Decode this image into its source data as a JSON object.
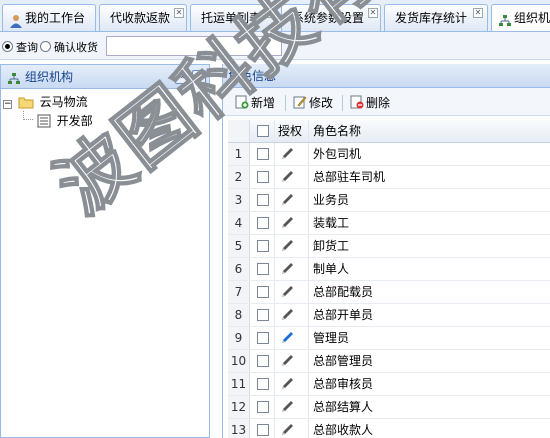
{
  "tabs": [
    {
      "label": "我的工作台",
      "closable": false,
      "active": false
    },
    {
      "label": "代收款返款",
      "closable": true,
      "active": false
    },
    {
      "label": "托运单列表",
      "closable": true,
      "active": false
    },
    {
      "label": "系统参数设置",
      "closable": true,
      "active": false
    },
    {
      "label": "发货库存统计",
      "closable": true,
      "active": false
    },
    {
      "label": "组织机",
      "closable": false,
      "active": true
    }
  ],
  "filter": {
    "radio_query": "查询",
    "radio_confirm": "确认收货",
    "input_value": ""
  },
  "left_panel": {
    "title": "组织机构",
    "tree": [
      {
        "label": "云马物流"
      },
      {
        "label": "开发部"
      }
    ]
  },
  "right_panel": {
    "title": "角色信息",
    "toolbar": {
      "add": "新增",
      "edit": "修改",
      "delete": "删除"
    },
    "grid": {
      "col_auth": "授权",
      "col_name": "角色名称",
      "rows": [
        {
          "num": "1",
          "name": "外包司机"
        },
        {
          "num": "2",
          "name": "总部驻车司机"
        },
        {
          "num": "3",
          "name": "业务员"
        },
        {
          "num": "4",
          "name": "装载工"
        },
        {
          "num": "5",
          "name": "卸货工"
        },
        {
          "num": "6",
          "name": "制单人"
        },
        {
          "num": "7",
          "name": "总部配载员"
        },
        {
          "num": "8",
          "name": "总部开单员"
        },
        {
          "num": "9",
          "name": "管理员"
        },
        {
          "num": "10",
          "name": "总部管理员"
        },
        {
          "num": "11",
          "name": "总部审核员"
        },
        {
          "num": "12",
          "name": "总部结算人"
        },
        {
          "num": "13",
          "name": "总部收款人"
        }
      ]
    }
  },
  "watermark": "波图科技有限公司",
  "colors": {
    "panel_border": "#99bbe8",
    "header_text": "#15428b",
    "pen_blue": "#1a6ed8"
  }
}
